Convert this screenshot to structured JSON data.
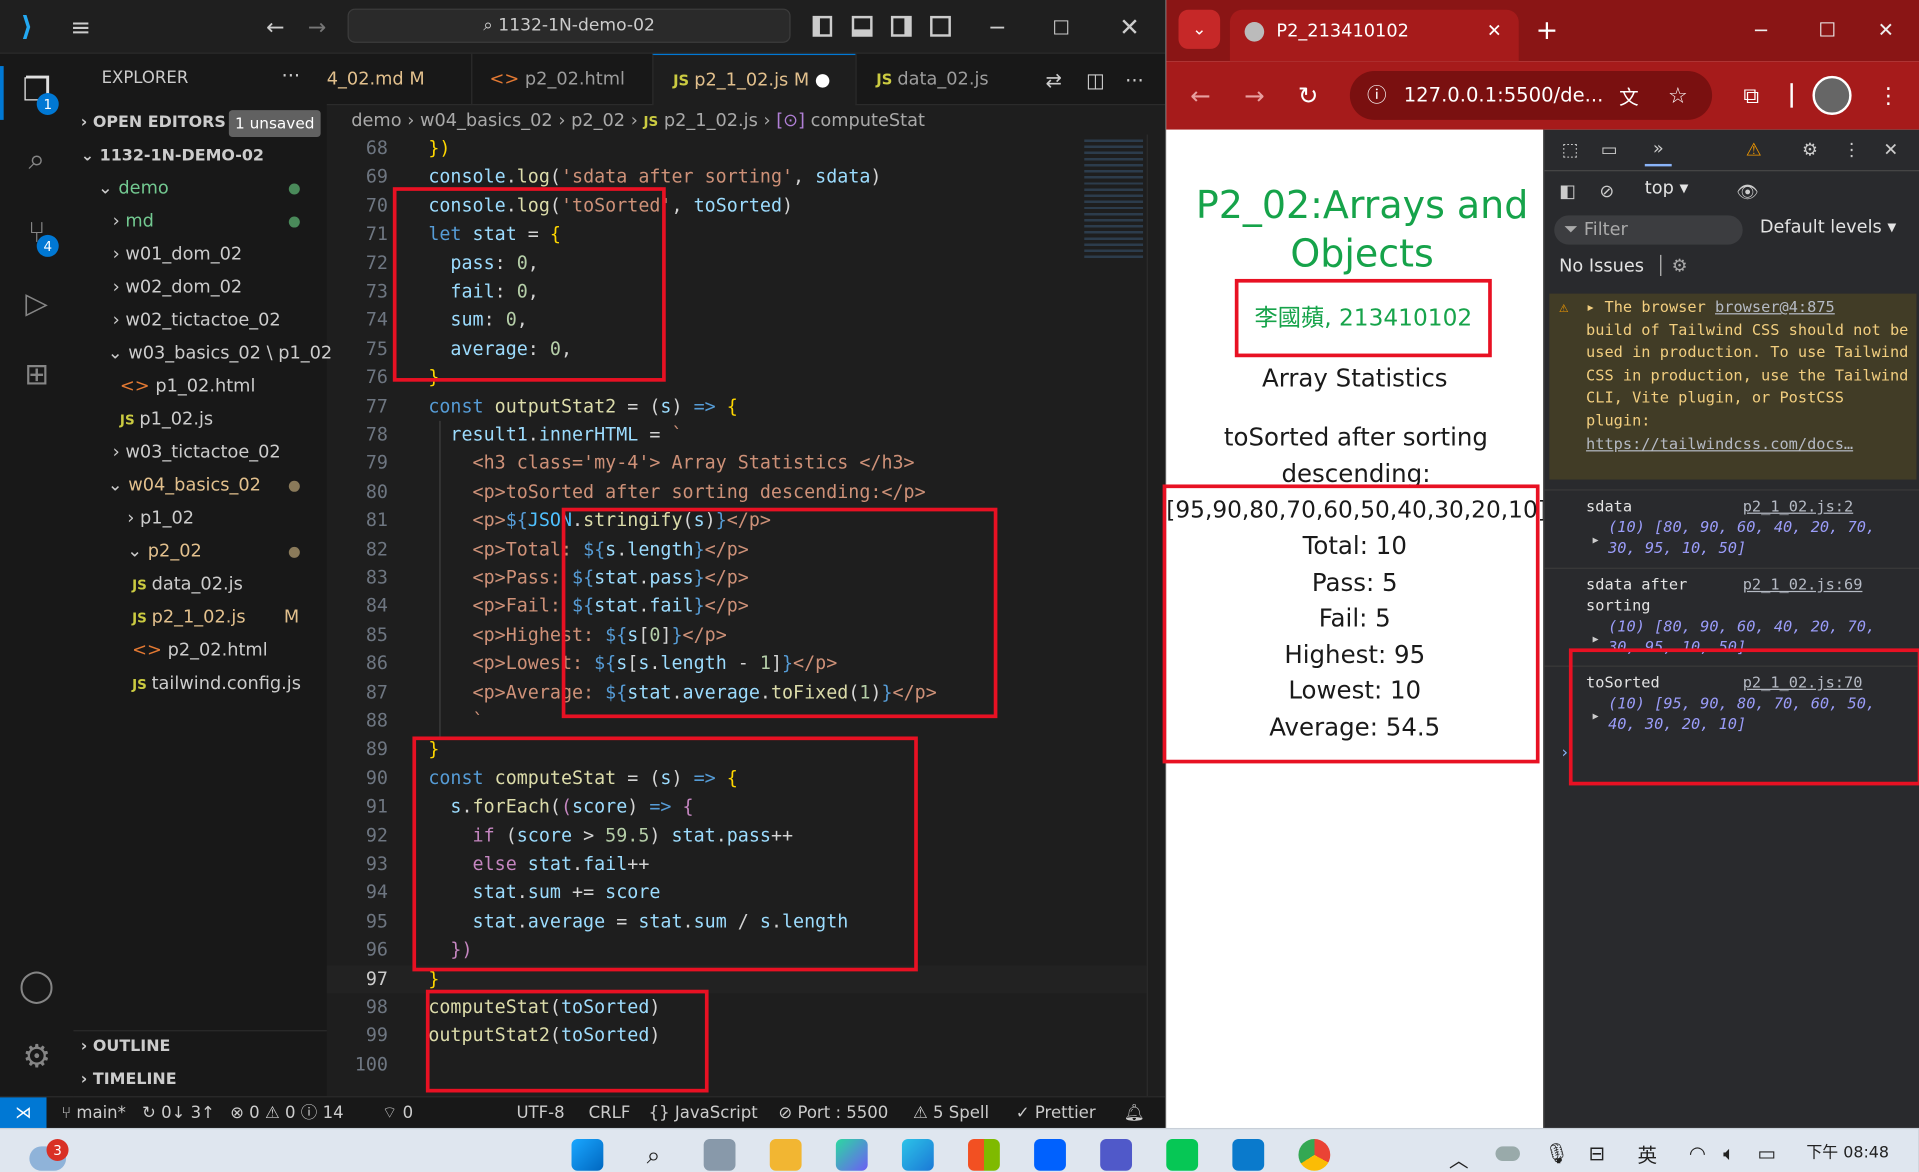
{
  "vscode": {
    "search_text": "1132-1N-demo-02",
    "explorer_title": "EXPLORER",
    "open_editors": "OPEN EDITORS",
    "unsaved_badge": "1 unsaved",
    "root_folder": "1132-1N-DEMO-02",
    "tree": [
      {
        "label": "demo",
        "kind": "folder-open",
        "status": "dot-green"
      },
      {
        "label": "md",
        "kind": "folder",
        "status": "dot-green"
      },
      {
        "label": "w01_dom_02",
        "kind": "folder",
        "status": ""
      },
      {
        "label": "w02_dom_02",
        "kind": "folder",
        "status": ""
      },
      {
        "label": "w02_tictactoe_02",
        "kind": "folder",
        "status": ""
      },
      {
        "label": "w03_basics_02 \\ p1_02",
        "kind": "folder-open",
        "status": ""
      },
      {
        "label": "p1_02.html",
        "kind": "html",
        "status": ""
      },
      {
        "label": "p1_02.js",
        "kind": "js",
        "status": ""
      },
      {
        "label": "w03_tictactoe_02",
        "kind": "folder",
        "status": ""
      },
      {
        "label": "w04_basics_02",
        "kind": "folder-open",
        "status": "dot-grey"
      },
      {
        "label": "p1_02",
        "kind": "folder",
        "status": ""
      },
      {
        "label": "p2_02",
        "kind": "folder-open",
        "status": "dot-grey"
      },
      {
        "label": "data_02.js",
        "kind": "js",
        "status": ""
      },
      {
        "label": "p2_1_02.js",
        "kind": "js",
        "status": "M"
      },
      {
        "label": "p2_02.html",
        "kind": "html",
        "status": ""
      },
      {
        "label": "tailwind.config.js",
        "kind": "js",
        "status": ""
      }
    ],
    "outline": "OUTLINE",
    "timeline": "TIMELINE",
    "tabs": [
      {
        "label": "4_02.md M",
        "icon": "markdown-icon"
      },
      {
        "label": "p2_02.html",
        "icon": "html-icon"
      },
      {
        "label": "p2_1_02.js M",
        "icon": "js-icon",
        "active": true
      },
      {
        "label": "data_02.js",
        "icon": "js-icon"
      }
    ],
    "breadcrumb": [
      "demo",
      "w04_basics_02",
      "p2_02",
      "p2_1_02.js",
      "computeStat"
    ],
    "code_lines": [
      {
        "n": "68",
        "html": "<span class='pu'>})</span>",
        "indent": 0
      },
      {
        "n": "69",
        "html": "<span class='vr'>console</span>.<span class='fn'>log</span>(<span class='st'>'sdata after sorting'</span>, <span class='vr'>sdata</span>)",
        "indent": 0
      },
      {
        "n": "70",
        "html": "<span class='vr'>console</span>.<span class='fn'>log</span>(<span class='st'>'toSorted'</span>, <span class='vr'>toSorted</span>)",
        "indent": 0
      },
      {
        "n": "71",
        "html": "<span class='kw'>let</span> <span class='vr'>stat</span> = <span class='pu'>{</span>",
        "indent": 0
      },
      {
        "n": "72",
        "html": "  <span class='vr'>pass</span>: <span class='nm'>0</span>,",
        "indent": 0
      },
      {
        "n": "73",
        "html": "  <span class='vr'>fail</span>: <span class='nm'>0</span>,",
        "indent": 0
      },
      {
        "n": "74",
        "html": "  <span class='vr'>sum</span>: <span class='nm'>0</span>,",
        "indent": 0
      },
      {
        "n": "75",
        "html": "  <span class='vr'>average</span>: <span class='nm'>0</span>,",
        "indent": 0
      },
      {
        "n": "76",
        "html": "<span class='pu'>}</span>",
        "indent": 0
      },
      {
        "n": "77",
        "html": "<span class='kw'>const</span> <span class='fn'>outputStat2</span> = (<span class='vr'>s</span>) <span class='kw'>=></span> <span class='pu'>{</span>",
        "indent": 0
      },
      {
        "n": "78",
        "html": "  <span class='vr'>result1</span>.<span class='vr'>innerHTML</span> = <span class='st'>`</span>",
        "indent": 0
      },
      {
        "n": "79",
        "html": "<span class='st'>    &lt;h3 class='my-4'&gt; Array Statistics &lt;/h3&gt;</span>",
        "indent": 0
      },
      {
        "n": "80",
        "html": "<span class='st'>    &lt;p&gt;toSorted after sorting descending:&lt;/p&gt;</span>",
        "indent": 0
      },
      {
        "n": "81",
        "html": "<span class='st'>    &lt;p&gt;</span><span class='kw'>${</span><span class='cv'>JSON</span>.<span class='fn'>stringify</span>(<span class='vr'>s</span>)<span class='kw'>}</span><span class='st'>&lt;/p&gt;</span>",
        "indent": 0
      },
      {
        "n": "82",
        "html": "<span class='st'>    &lt;p&gt;Total: </span><span class='kw'>${</span><span class='vr'>s</span>.<span class='vr'>length</span><span class='kw'>}</span><span class='st'>&lt;/p&gt;</span>",
        "indent": 0
      },
      {
        "n": "83",
        "html": "<span class='st'>    &lt;p&gt;Pass: </span><span class='kw'>${</span><span class='vr'>stat</span>.<span class='vr'>pass</span><span class='kw'>}</span><span class='st'>&lt;/p&gt;</span>",
        "indent": 0
      },
      {
        "n": "84",
        "html": "<span class='st'>    &lt;p&gt;Fail: </span><span class='kw'>${</span><span class='vr'>stat</span>.<span class='vr'>fail</span><span class='kw'>}</span><span class='st'>&lt;/p&gt;</span>",
        "indent": 0
      },
      {
        "n": "85",
        "html": "<span class='st'>    &lt;p&gt;Highest: </span><span class='kw'>${</span><span class='vr'>s</span>[<span class='nm'>0</span>]<span class='kw'>}</span><span class='st'>&lt;/p&gt;</span>",
        "indent": 0
      },
      {
        "n": "86",
        "html": "<span class='st'>    &lt;p&gt;Lowest: </span><span class='kw'>${</span><span class='vr'>s</span>[<span class='vr'>s</span>.<span class='vr'>length</span> - <span class='nm'>1</span>]<span class='kw'>}</span><span class='st'>&lt;/p&gt;</span>",
        "indent": 0
      },
      {
        "n": "87",
        "html": "<span class='st'>    &lt;p&gt;Average: </span><span class='kw'>${</span><span class='vr'>stat</span>.<span class='vr'>average</span>.<span class='fn'>toFixed</span>(<span class='nm'>1</span>)<span class='kw'>}</span><span class='st'>&lt;/p&gt;</span>",
        "indent": 0
      },
      {
        "n": "88",
        "html": "<span class='st'>    `</span>",
        "indent": 0
      },
      {
        "n": "89",
        "html": "<span class='pu'>}</span>",
        "indent": 0
      },
      {
        "n": "90",
        "html": "<span class='kw'>const</span> <span class='fn'>computeStat</span> = (<span class='vr'>s</span>) <span class='kw'>=></span> <span class='pu'>{</span>",
        "indent": 0
      },
      {
        "n": "91",
        "html": "  <span class='vr'>s</span>.<span class='fn'>forEach</span>(<span class='pk'>(</span><span class='vr'>score</span>) <span class='kw'>=></span> <span class='pk'>{</span>",
        "indent": 0
      },
      {
        "n": "92",
        "html": "    <span class='pk'>if</span> (<span class='vr'>score</span> &gt; <span class='nm'>59.5</span>) <span class='vr'>stat</span>.<span class='vr'>pass</span>++",
        "indent": 0
      },
      {
        "n": "93",
        "html": "    <span class='pk'>else</span> <span class='vr'>stat</span>.<span class='vr'>fail</span>++",
        "indent": 0
      },
      {
        "n": "94",
        "html": "    <span class='vr'>stat</span>.<span class='vr'>sum</span> += <span class='vr'>score</span>",
        "indent": 0
      },
      {
        "n": "95",
        "html": "    <span class='vr'>stat</span>.<span class='vr'>average</span> = <span class='vr'>stat</span>.<span class='vr'>sum</span> / <span class='vr'>s</span>.<span class='vr'>length</span>",
        "indent": 0
      },
      {
        "n": "96",
        "html": "  <span class='pk'>})</span>",
        "indent": 0
      },
      {
        "n": "97",
        "html": "<span class='pu'>}</span>",
        "indent": 0
      },
      {
        "n": "98",
        "html": "<span class='fn'>computeStat</span>(<span class='vr'>toSorted</span>)",
        "indent": 0
      },
      {
        "n": "99",
        "html": "<span class='fn'>outputStat2</span>(<span class='vr'>toSorted</span>)",
        "indent": 0
      },
      {
        "n": "100",
        "html": "",
        "indent": 0
      }
    ],
    "status": {
      "branch": "main*",
      "sync": "0↓ 3↑",
      "problems": "0",
      "warnings": "0",
      "info": "14",
      "ports_count": "0",
      "encoding": "UTF-8",
      "eol": "CRLF",
      "language": "JavaScript",
      "port": "Port : 5500",
      "spell": "5 Spell",
      "prettier": "Prettier"
    },
    "activity_badges": {
      "explorer": "1",
      "scm": "4"
    }
  },
  "chrome": {
    "tab_title": "P2_213410102",
    "url": "127.0.0.1:5500/de...",
    "page": {
      "title": "P2_02:Arrays and Objects",
      "student": "李國蘋, 213410102",
      "heading": "Array Statistics",
      "label": "toSorted after sorting descending:",
      "array": "[95,90,80,70,60,50,40,30,20,10]",
      "stats": [
        "Total: 10",
        "Pass: 5",
        "Fail: 5",
        "Highest: 95",
        "Lowest: 10",
        "Average: 54.5"
      ]
    },
    "devtools": {
      "context": "top",
      "filter_placeholder": "Filter",
      "levels": "Default levels",
      "no_issues": "No Issues",
      "warning_link": "browser@4:875",
      "warning_prefix": "The browser",
      "warning_text": "build of Tailwind CSS should not be used in production. To use Tailwind CSS in production, use the Tailwind CLI, Vite plugin, or PostCSS plugin:",
      "warning_url": "https://tailwindcss.com/docs…",
      "logs": [
        {
          "label": "sdata",
          "src": "p2_1_02.js:2",
          "value": "(10) [80, 90, 60, 40, 20, 70, 30, 95, 10, 50]"
        },
        {
          "label": "sdata after sorting",
          "src": "p2_1_02.js:69",
          "value": "(10) [80, 90, 60, 40, 20, 70, 30, 95, 10, 50]"
        },
        {
          "label": "toSorted",
          "src": "p2_1_02.js:70",
          "value": "(10) [95, 90, 80, 70, 60, 50, 40, 30, 20, 10]"
        }
      ]
    }
  },
  "taskbar": {
    "weather_badge": "3",
    "ime": "英",
    "time": "下午 08:48"
  }
}
